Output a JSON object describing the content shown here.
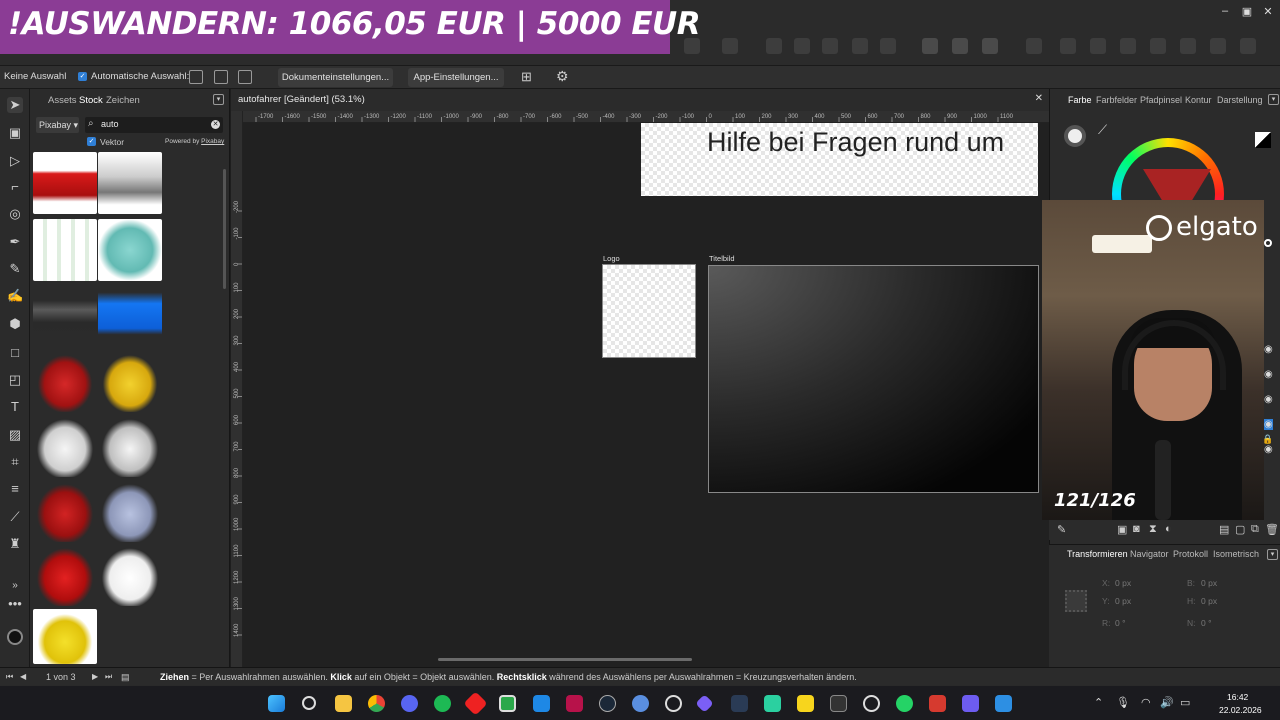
{
  "banner": {
    "text": "!AUSWANDERN: 1066,05 EUR | 5000 EUR"
  },
  "window": {
    "minimize": "–",
    "maximize": "▣",
    "close": "✕"
  },
  "context_bar": {
    "selection": "Keine Auswahl",
    "auto_select": "Automatische Auswahl:",
    "doc_settings": "Dokumenteinstellungen...",
    "app_settings": "App-Einstellungen..."
  },
  "assets_panel": {
    "tabs": [
      "Assets",
      "Stock",
      "Zeichen"
    ],
    "active_tab": "Stock",
    "source": "Pixabay",
    "search_value": "auto",
    "vektor_label": "Vektor",
    "powered_prefix": "Powered by ",
    "powered_brand": "Pixabay"
  },
  "document": {
    "title": "autofahrer [Geändert] (53.1%)",
    "ruler_h": [
      "-1700",
      "-1600",
      "-1500",
      "-1400",
      "-1300",
      "-1200",
      "-1100",
      "-1000",
      "-900",
      "-800",
      "-700",
      "-600",
      "-500",
      "-400",
      "-300",
      "-200",
      "-100",
      "0",
      "100",
      "200",
      "300",
      "400",
      "500",
      "600",
      "700",
      "800",
      "900",
      "1000",
      "1100"
    ],
    "ruler_v": [
      "-200",
      "-100",
      "0",
      "100",
      "200",
      "300",
      "400",
      "500",
      "600",
      "700",
      "800",
      "900",
      "1000",
      "1100",
      "1200",
      "1300",
      "1400"
    ],
    "artboards": {
      "banner_text": "Hilfe bei Fragen rund um",
      "logo_label": "Logo",
      "titel_label": "Titelbild"
    }
  },
  "right_panel": {
    "tabs": [
      "Farbe",
      "Farbfelder",
      "Pfadpinsel",
      "Kontur",
      "Darstellung"
    ],
    "active_tab": "Farbe",
    "transform_tabs": [
      "Transformieren",
      "Navigator",
      "Protokoll",
      "Isometrisch"
    ],
    "active_transform_tab": "Transformieren",
    "fields": {
      "x_label": "X:",
      "x": "0 px",
      "b_label": "B:",
      "b": "0 px",
      "y_label": "Y:",
      "y": "0 px",
      "h_label": "H:",
      "h": "0 px",
      "r_label": "R:",
      "r": "0 °",
      "n_label": "N:",
      "n": "0 °"
    }
  },
  "webcam": {
    "brand": "elgato",
    "counter": "121/126"
  },
  "statusbar": {
    "page": "1 von 3",
    "hint_1_bold": "Ziehen",
    "hint_1": " = Per Auswahlrahmen auswählen. ",
    "hint_2_bold": "Klick",
    "hint_2": " auf ein Objekt = Objekt auswählen. ",
    "hint_3_bold": "Rechtsklick",
    "hint_3": " während des Auswählens per Auswahlrahmen = Kreuzungsverhalten ändern."
  },
  "taskbar": {
    "time": "16:42",
    "date": "22.02.2026"
  },
  "colors": {
    "banner": "#8b3c95",
    "accent": "#2f7fd6"
  }
}
